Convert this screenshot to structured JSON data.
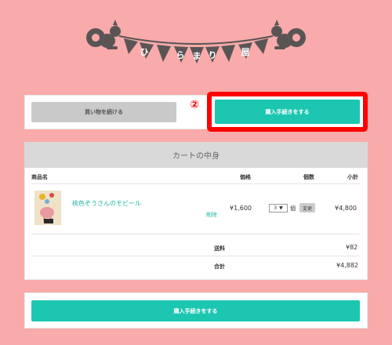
{
  "logo": {
    "letters": [
      "ひ",
      "ら",
      "ま",
      "り",
      "屋"
    ]
  },
  "actions_top": {
    "continue_label": "買い物を続ける",
    "checkout_label": "購入手続きをする",
    "annotation_number": "②"
  },
  "cart": {
    "title": "カートの中身",
    "columns": {
      "product": "商品名",
      "price": "価格",
      "qty": "個数",
      "subtotal": "小計"
    },
    "item": {
      "name": "桃色ぞうさんのモビール",
      "delete_label": "削除",
      "price": "¥1,600",
      "qty_value": "3",
      "qty_unit": "個",
      "update_label": "変更",
      "subtotal": "¥4,800"
    },
    "shipping_label": "送料",
    "shipping_value": "¥82",
    "total_label": "合計",
    "total_value": "¥4,882"
  },
  "actions_bottom": {
    "checkout_label": "購入手続きをする"
  },
  "colors": {
    "background": "#f9aaaa",
    "accent_teal": "#1cc6b1",
    "highlight_red": "#ff0000"
  }
}
